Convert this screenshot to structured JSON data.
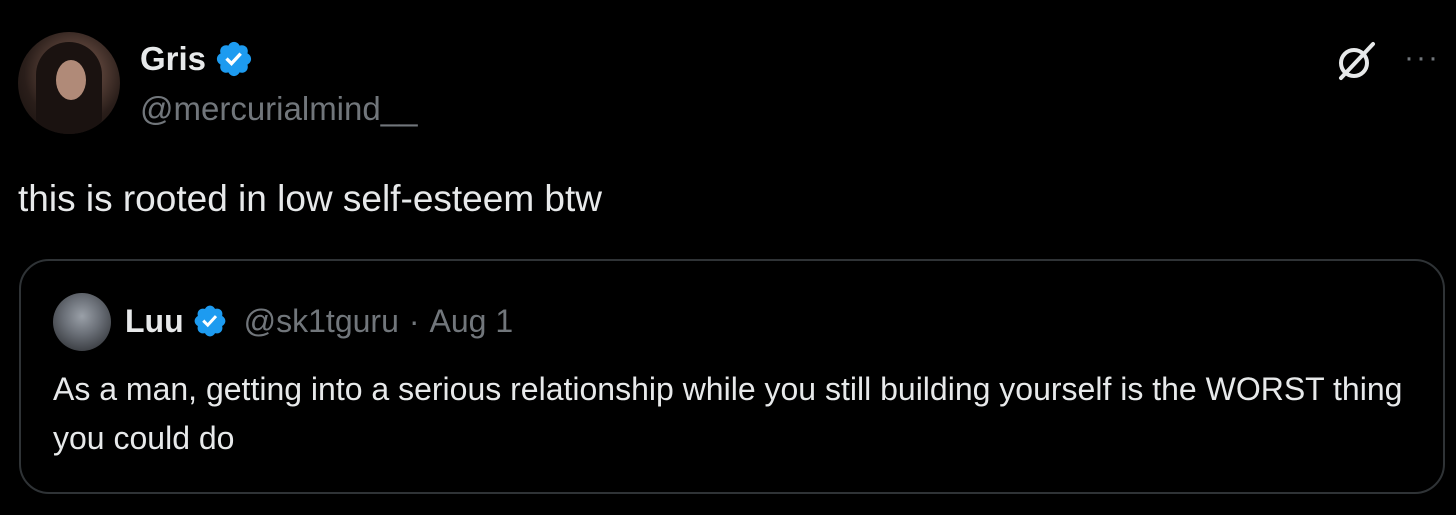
{
  "tweet": {
    "author_name": "Gris",
    "author_handle": "@mercurialmind__",
    "text": "this is rooted in low self-esteem btw",
    "more_label": "···"
  },
  "quoted_tweet": {
    "author_name": "Luu",
    "author_handle": "@sk1tguru",
    "separator": "·",
    "date": "Aug 1",
    "text": "As a man, getting into a serious relationship while you still building yourself is the WORST thing you could do"
  },
  "colors": {
    "background": "#000000",
    "primary_text": "#e7e9ea",
    "secondary_text": "#71767b",
    "verified_badge": "#1d9bf0",
    "border": "#2f3336"
  },
  "icons": {
    "verified": "verified-badge-icon",
    "grok": "grok-icon",
    "more": "more-options-icon"
  }
}
